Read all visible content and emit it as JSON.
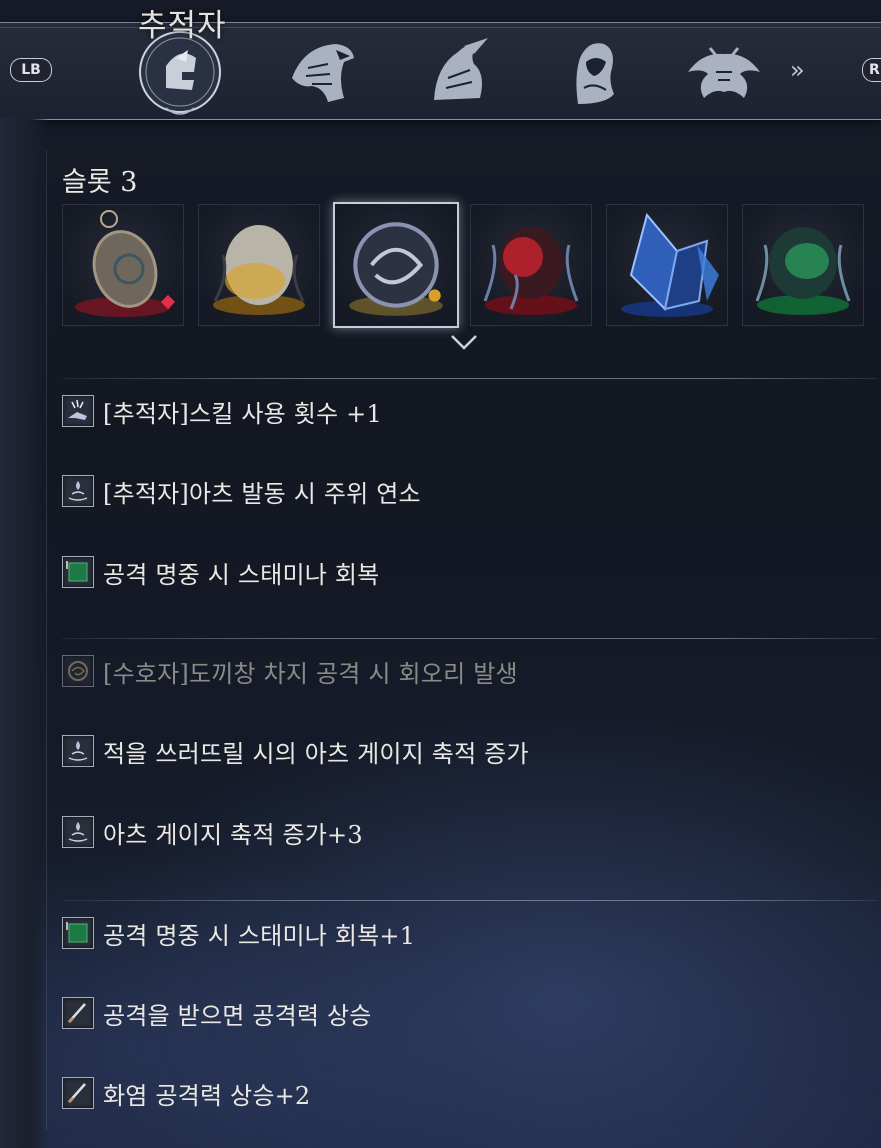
{
  "header": {
    "title": "추적자",
    "lb_label": "LB",
    "rb_label": "R",
    "more_glyph": "»",
    "characters": [
      {
        "icon": "wylder-helmet-icon",
        "selected": true
      },
      {
        "icon": "eagle-head-icon",
        "selected": false
      },
      {
        "icon": "hooded-bird-icon",
        "selected": false
      },
      {
        "icon": "hooded-figure-icon",
        "selected": false
      },
      {
        "icon": "beast-crest-icon",
        "selected": false
      }
    ]
  },
  "relics": {
    "slot_label": "슬롯 3",
    "items": [
      {
        "icon": "amulet-relic-icon",
        "color": "#c0283a",
        "selected": false
      },
      {
        "icon": "yellow-egg-relic-icon",
        "color": "#d4a22a",
        "selected": false
      },
      {
        "icon": "swirl-orb-relic-icon",
        "color": "#8a93b0",
        "selected": true
      },
      {
        "icon": "red-egg-relic-icon",
        "color": "#c22330",
        "selected": false
      },
      {
        "icon": "blue-crystal-relic-icon",
        "color": "#3d7fe0",
        "selected": false
      },
      {
        "icon": "green-egg-relic-icon",
        "color": "#2fbf6a",
        "selected": false
      }
    ]
  },
  "effects": {
    "group1": [
      {
        "text": "[추적자]스킬 사용 횟수 +1",
        "icon": "skill-hand-icon",
        "dim": false
      },
      {
        "text": "[추적자]아츠 발동 시 주위 연소",
        "icon": "arts-swirl-icon",
        "dim": false
      },
      {
        "text": "공격 명중 시 스태미나 회복",
        "icon": "stamina-green-icon",
        "dim": false
      }
    ],
    "group2": [
      {
        "text": "[수호자]도끼창 차지 공격 시 회오리 발생",
        "icon": "whirlwind-icon",
        "dim": true
      },
      {
        "text": "적을 쓰러뜨릴 시의 아츠 게이지 축적 증가",
        "icon": "arts-swirl-icon",
        "dim": false
      },
      {
        "text": "아츠 게이지 축적 증가+3",
        "icon": "arts-swirl-icon",
        "dim": false
      }
    ],
    "group3": [
      {
        "text": "공격 명중 시 스태미나 회복+1",
        "icon": "stamina-green-icon",
        "dim": false
      },
      {
        "text": "공격을 받으면 공격력 상승",
        "icon": "sword-icon",
        "dim": false
      },
      {
        "text": "화염 공격력 상승+2",
        "icon": "sword-icon",
        "dim": false
      }
    ]
  }
}
